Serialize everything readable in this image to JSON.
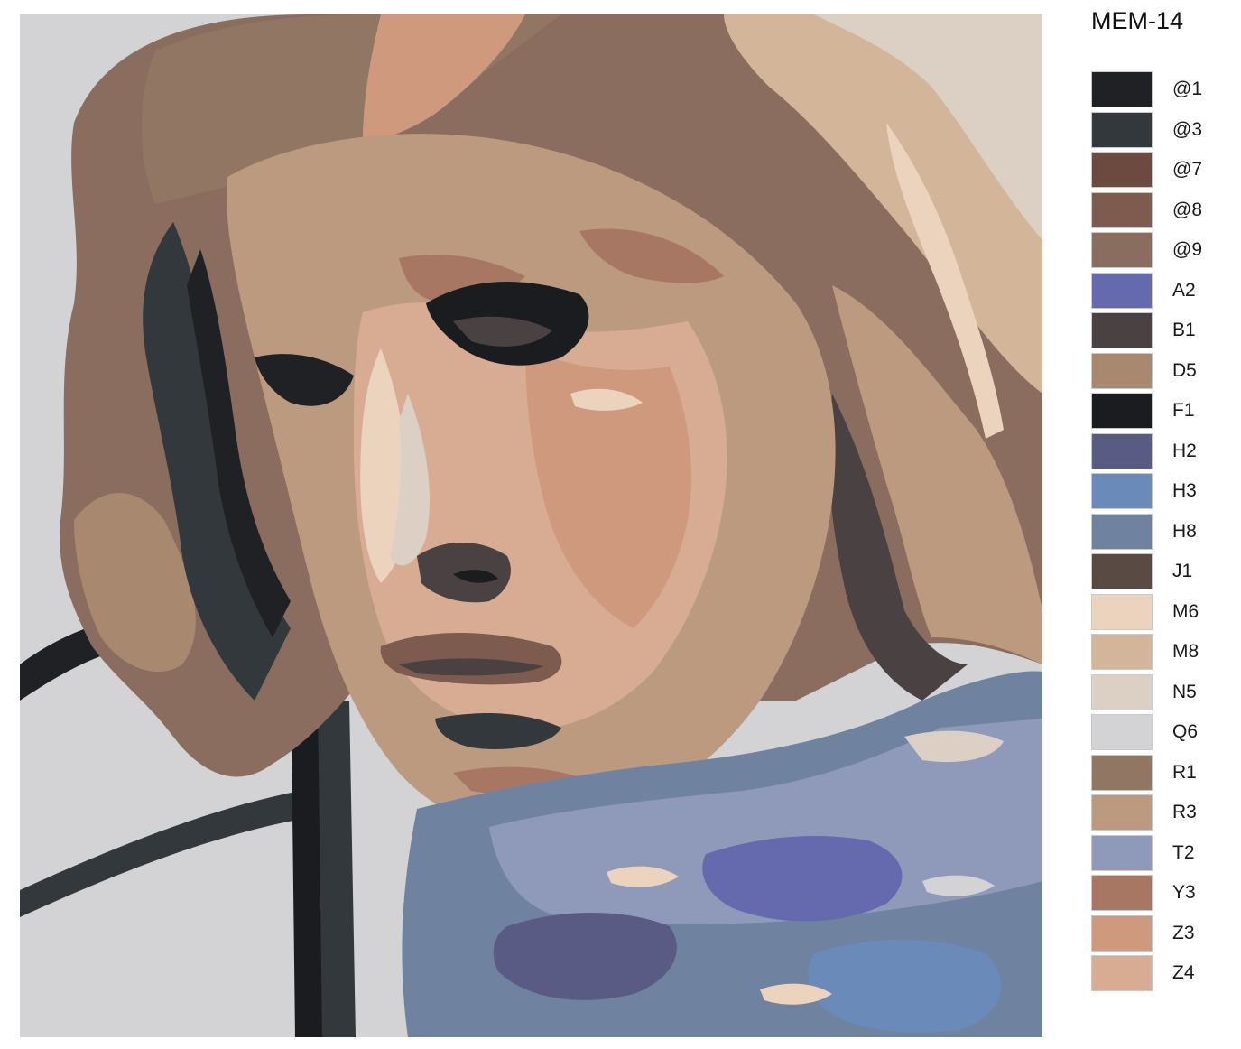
{
  "title": "MEM-14",
  "legend": [
    {
      "code": "@1",
      "color": "#1f2124"
    },
    {
      "code": "@3",
      "color": "#33383d"
    },
    {
      "code": "@7",
      "color": "#6c4a40"
    },
    {
      "code": "@8",
      "color": "#7d5b4e"
    },
    {
      "code": "@9",
      "color": "#8a6d5f"
    },
    {
      "code": "A2",
      "color": "#6569ad"
    },
    {
      "code": "B1",
      "color": "#4a4143"
    },
    {
      "code": "D5",
      "color": "#a8886f"
    },
    {
      "code": "F1",
      "color": "#1b1c1f"
    },
    {
      "code": "H2",
      "color": "#5a5b84"
    },
    {
      "code": "H3",
      "color": "#6a8bb9"
    },
    {
      "code": "H8",
      "color": "#6f83a1"
    },
    {
      "code": "J1",
      "color": "#5a4a44"
    },
    {
      "code": "M6",
      "color": "#ebd3bd"
    },
    {
      "code": "M8",
      "color": "#d3b69a"
    },
    {
      "code": "N5",
      "color": "#dcd0c4"
    },
    {
      "code": "Q6",
      "color": "#d3d3d6"
    },
    {
      "code": "R1",
      "color": "#917663"
    },
    {
      "code": "R3",
      "color": "#bc9a7f"
    },
    {
      "code": "T2",
      "color": "#8f9abb"
    },
    {
      "code": "Y3",
      "color": "#a87764"
    },
    {
      "code": "Z3",
      "color": "#cf997e"
    },
    {
      "code": "Z4",
      "color": "#d8ac92"
    }
  ]
}
